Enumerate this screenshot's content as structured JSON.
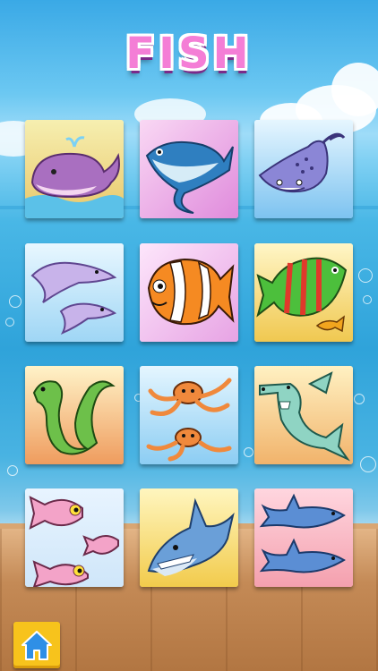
{
  "title": "FISH",
  "tiles": [
    {
      "name": "whale",
      "icon": "whale-icon",
      "bg": [
        "#f6efb0",
        "#e9c76a"
      ]
    },
    {
      "name": "tuna",
      "icon": "tuna-icon",
      "bg": [
        "#f9d8f4",
        "#e08bdc"
      ]
    },
    {
      "name": "stingray",
      "icon": "stingray-icon",
      "bg": [
        "#e6f6ff",
        "#7dc3f0"
      ]
    },
    {
      "name": "dolphin",
      "icon": "dolphin-icon",
      "bg": [
        "#e8f7ff",
        "#9fd6f5"
      ]
    },
    {
      "name": "clownfish",
      "icon": "clownfish-icon",
      "bg": [
        "#fde6fb",
        "#e7a3e4"
      ]
    },
    {
      "name": "striped-fish",
      "icon": "striped-fish-icon",
      "bg": [
        "#fff6c7",
        "#f0c850"
      ]
    },
    {
      "name": "eel",
      "icon": "eel-icon",
      "bg": [
        "#fff3c8",
        "#ef9c5e"
      ]
    },
    {
      "name": "octopus",
      "icon": "octopus-icon",
      "bg": [
        "#e5f6ff",
        "#8ccdf3"
      ]
    },
    {
      "name": "hammerhead-shark",
      "icon": "hammerhead-shark-icon",
      "bg": [
        "#fff1c2",
        "#f1b36b"
      ]
    },
    {
      "name": "pink-fish",
      "icon": "pink-fish-icon",
      "bg": [
        "#e8f4ff",
        "#cfe6f9"
      ]
    },
    {
      "name": "shark",
      "icon": "shark-icon",
      "bg": [
        "#fff6bf",
        "#f2cb4c"
      ]
    },
    {
      "name": "sharks",
      "icon": "sharks-icon",
      "bg": [
        "#ffd6df",
        "#f4a0ae"
      ]
    }
  ],
  "home_icon": "home-icon"
}
